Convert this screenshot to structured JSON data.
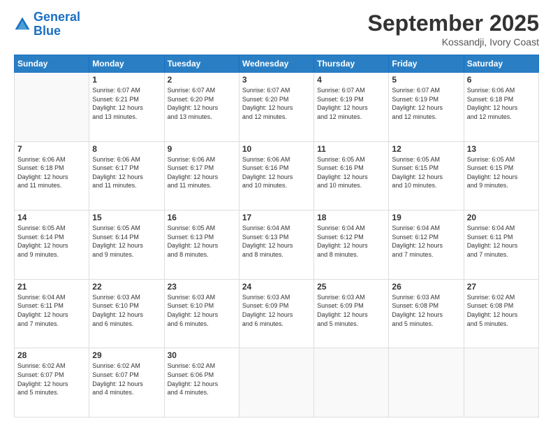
{
  "header": {
    "logo_line1": "General",
    "logo_line2": "Blue",
    "month": "September 2025",
    "location": "Kossandji, Ivory Coast"
  },
  "days_of_week": [
    "Sunday",
    "Monday",
    "Tuesday",
    "Wednesday",
    "Thursday",
    "Friday",
    "Saturday"
  ],
  "weeks": [
    [
      {
        "num": "",
        "info": ""
      },
      {
        "num": "1",
        "info": "Sunrise: 6:07 AM\nSunset: 6:21 PM\nDaylight: 12 hours\nand 13 minutes."
      },
      {
        "num": "2",
        "info": "Sunrise: 6:07 AM\nSunset: 6:20 PM\nDaylight: 12 hours\nand 13 minutes."
      },
      {
        "num": "3",
        "info": "Sunrise: 6:07 AM\nSunset: 6:20 PM\nDaylight: 12 hours\nand 12 minutes."
      },
      {
        "num": "4",
        "info": "Sunrise: 6:07 AM\nSunset: 6:19 PM\nDaylight: 12 hours\nand 12 minutes."
      },
      {
        "num": "5",
        "info": "Sunrise: 6:07 AM\nSunset: 6:19 PM\nDaylight: 12 hours\nand 12 minutes."
      },
      {
        "num": "6",
        "info": "Sunrise: 6:06 AM\nSunset: 6:18 PM\nDaylight: 12 hours\nand 12 minutes."
      }
    ],
    [
      {
        "num": "7",
        "info": "Sunrise: 6:06 AM\nSunset: 6:18 PM\nDaylight: 12 hours\nand 11 minutes."
      },
      {
        "num": "8",
        "info": "Sunrise: 6:06 AM\nSunset: 6:17 PM\nDaylight: 12 hours\nand 11 minutes."
      },
      {
        "num": "9",
        "info": "Sunrise: 6:06 AM\nSunset: 6:17 PM\nDaylight: 12 hours\nand 11 minutes."
      },
      {
        "num": "10",
        "info": "Sunrise: 6:06 AM\nSunset: 6:16 PM\nDaylight: 12 hours\nand 10 minutes."
      },
      {
        "num": "11",
        "info": "Sunrise: 6:05 AM\nSunset: 6:16 PM\nDaylight: 12 hours\nand 10 minutes."
      },
      {
        "num": "12",
        "info": "Sunrise: 6:05 AM\nSunset: 6:15 PM\nDaylight: 12 hours\nand 10 minutes."
      },
      {
        "num": "13",
        "info": "Sunrise: 6:05 AM\nSunset: 6:15 PM\nDaylight: 12 hours\nand 9 minutes."
      }
    ],
    [
      {
        "num": "14",
        "info": "Sunrise: 6:05 AM\nSunset: 6:14 PM\nDaylight: 12 hours\nand 9 minutes."
      },
      {
        "num": "15",
        "info": "Sunrise: 6:05 AM\nSunset: 6:14 PM\nDaylight: 12 hours\nand 9 minutes."
      },
      {
        "num": "16",
        "info": "Sunrise: 6:05 AM\nSunset: 6:13 PM\nDaylight: 12 hours\nand 8 minutes."
      },
      {
        "num": "17",
        "info": "Sunrise: 6:04 AM\nSunset: 6:13 PM\nDaylight: 12 hours\nand 8 minutes."
      },
      {
        "num": "18",
        "info": "Sunrise: 6:04 AM\nSunset: 6:12 PM\nDaylight: 12 hours\nand 8 minutes."
      },
      {
        "num": "19",
        "info": "Sunrise: 6:04 AM\nSunset: 6:12 PM\nDaylight: 12 hours\nand 7 minutes."
      },
      {
        "num": "20",
        "info": "Sunrise: 6:04 AM\nSunset: 6:11 PM\nDaylight: 12 hours\nand 7 minutes."
      }
    ],
    [
      {
        "num": "21",
        "info": "Sunrise: 6:04 AM\nSunset: 6:11 PM\nDaylight: 12 hours\nand 7 minutes."
      },
      {
        "num": "22",
        "info": "Sunrise: 6:03 AM\nSunset: 6:10 PM\nDaylight: 12 hours\nand 6 minutes."
      },
      {
        "num": "23",
        "info": "Sunrise: 6:03 AM\nSunset: 6:10 PM\nDaylight: 12 hours\nand 6 minutes."
      },
      {
        "num": "24",
        "info": "Sunrise: 6:03 AM\nSunset: 6:09 PM\nDaylight: 12 hours\nand 6 minutes."
      },
      {
        "num": "25",
        "info": "Sunrise: 6:03 AM\nSunset: 6:09 PM\nDaylight: 12 hours\nand 5 minutes."
      },
      {
        "num": "26",
        "info": "Sunrise: 6:03 AM\nSunset: 6:08 PM\nDaylight: 12 hours\nand 5 minutes."
      },
      {
        "num": "27",
        "info": "Sunrise: 6:02 AM\nSunset: 6:08 PM\nDaylight: 12 hours\nand 5 minutes."
      }
    ],
    [
      {
        "num": "28",
        "info": "Sunrise: 6:02 AM\nSunset: 6:07 PM\nDaylight: 12 hours\nand 5 minutes."
      },
      {
        "num": "29",
        "info": "Sunrise: 6:02 AM\nSunset: 6:07 PM\nDaylight: 12 hours\nand 4 minutes."
      },
      {
        "num": "30",
        "info": "Sunrise: 6:02 AM\nSunset: 6:06 PM\nDaylight: 12 hours\nand 4 minutes."
      },
      {
        "num": "",
        "info": ""
      },
      {
        "num": "",
        "info": ""
      },
      {
        "num": "",
        "info": ""
      },
      {
        "num": "",
        "info": ""
      }
    ]
  ]
}
